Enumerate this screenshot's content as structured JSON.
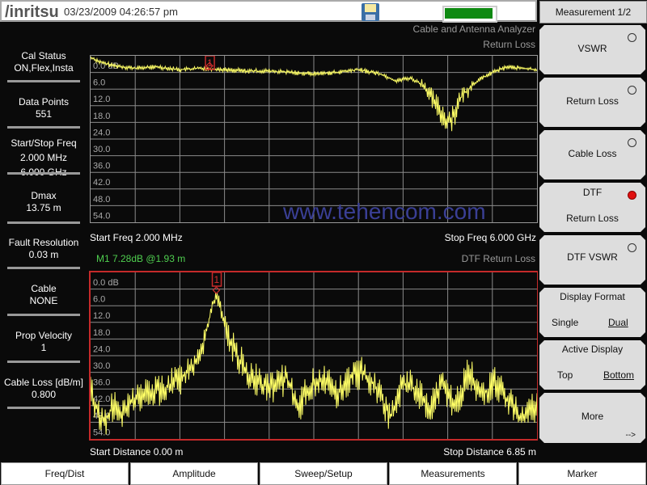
{
  "header": {
    "logo": "/inritsu",
    "datetime": "03/23/2009 04:26:57 pm",
    "icons": [
      "save-disk-icon",
      "battery-icon"
    ],
    "battery_level_percent": 95
  },
  "titles": {
    "instrument": "Cable and Antenna Analyzer",
    "top_measurement": "Return Loss",
    "bottom_measurement": "DTF Return Loss"
  },
  "left_panel": [
    {
      "label": "Cal Status",
      "value": "ON,Flex,Insta"
    },
    {
      "label": "Data Points",
      "value": "551"
    },
    {
      "label": "Start/Stop Freq",
      "value": "2.000 MHz",
      "value2": "6.000 GHz"
    },
    {
      "label": "Dmax",
      "value": "13.75 m"
    },
    {
      "label": "Fault Resolution",
      "value": "0.03 m"
    },
    {
      "label": "Cable",
      "value": "NONE"
    },
    {
      "label": "Prop Velocity",
      "value": "1"
    },
    {
      "label": "Cable Loss [dB/m]",
      "value": "0.800"
    }
  ],
  "top_plot": {
    "start_label": "Start Freq 2.000 MHz",
    "stop_label": "Stop Freq 6.000 GHz",
    "marker_label": "1"
  },
  "bottom_plot": {
    "marker_readout": "M1 7.28dB @1.93 m",
    "start_label": "Start Distance 0.00 m",
    "stop_label": "Stop Distance 6.85 m",
    "marker_label": "1"
  },
  "watermark": "www.tehencom.com",
  "softkeys": {
    "title": "Measurement 1/2",
    "items": [
      {
        "label": "VSWR",
        "radio": "off"
      },
      {
        "label": "Return Loss",
        "radio": "off"
      },
      {
        "label": "Cable Loss",
        "radio": "off"
      },
      {
        "label": "DTF",
        "label2": "Return Loss",
        "radio": "on"
      },
      {
        "label": "DTF VSWR",
        "radio": "off"
      },
      {
        "label": "Display Format",
        "opt1": "Single",
        "opt2": "Dual",
        "selected": "Dual"
      },
      {
        "label": "Active Display",
        "opt1": "Top",
        "opt2": "Bottom",
        "selected": "Bottom"
      },
      {
        "label": "More",
        "arrow": "-->"
      }
    ]
  },
  "tabs": [
    "Freq/Dist",
    "Amplitude",
    "Sweep/Setup",
    "Measurements",
    "Marker"
  ],
  "chart_data": [
    {
      "type": "line",
      "title": "Return Loss",
      "xlabel": "Frequency",
      "ylabel": "dB",
      "x_range": [
        0.002,
        6.0
      ],
      "x_unit": "GHz",
      "ylim": [
        0,
        60
      ],
      "y_inverted": true,
      "y_ticks": [
        "0.0 dB",
        "6.0",
        "12.0",
        "18.0",
        "24.0",
        "30.0",
        "36.0",
        "42.0",
        "48.0",
        "54.0"
      ],
      "grid": true,
      "trace_color": "#ffff66",
      "series": [
        {
          "name": "Return Loss",
          "x": [
            0.002,
            0.15,
            0.3,
            0.6,
            0.9,
            1.2,
            1.5,
            1.8,
            2.1,
            2.4,
            2.7,
            3.0,
            3.3,
            3.6,
            3.9,
            4.1,
            4.3,
            4.5,
            4.6,
            4.7,
            4.8,
            4.9,
            5.0,
            5.2,
            5.4,
            5.6,
            5.8,
            6.0
          ],
          "values": [
            0.5,
            2.5,
            3.5,
            4.5,
            4.0,
            5.0,
            4.5,
            5.0,
            5.5,
            5.5,
            6.0,
            6.5,
            6.0,
            5.0,
            6.5,
            9.0,
            8.0,
            11.0,
            16.0,
            20.0,
            24.0,
            20.0,
            14.0,
            9.0,
            6.0,
            4.0,
            4.5,
            5.0
          ]
        }
      ],
      "markers": [
        {
          "id": "1",
          "x": 1.6,
          "value": 4.5
        }
      ]
    },
    {
      "type": "line",
      "title": "DTF Return Loss",
      "xlabel": "Distance",
      "ylabel": "dB",
      "x_range": [
        0.0,
        6.85
      ],
      "x_unit": "m",
      "ylim": [
        0,
        60
      ],
      "y_inverted": true,
      "y_ticks": [
        "0.0 dB",
        "6.0",
        "12.0",
        "18.0",
        "24.0",
        "30.0",
        "36.0",
        "42.0",
        "48.0",
        "54.0"
      ],
      "grid": true,
      "trace_color": "#ffff66",
      "series": [
        {
          "name": "DTF Return Loss",
          "x": [
            0.0,
            0.1,
            0.2,
            0.35,
            0.5,
            0.65,
            0.8,
            1.0,
            1.2,
            1.4,
            1.6,
            1.75,
            1.85,
            1.93,
            2.0,
            2.1,
            2.25,
            2.4,
            2.6,
            2.8,
            3.0,
            3.2,
            3.4,
            3.6,
            3.8,
            4.0,
            4.2,
            4.4,
            4.6,
            4.8,
            5.0,
            5.2,
            5.4,
            5.6,
            5.8,
            6.0,
            6.2,
            6.4,
            6.6,
            6.85
          ],
          "values": [
            42.0,
            50.0,
            54.0,
            48.0,
            52.0,
            46.0,
            44.0,
            43.0,
            41.0,
            38.0,
            33.0,
            24.0,
            14.0,
            7.28,
            14.0,
            24.0,
            30.0,
            36.0,
            40.0,
            42.0,
            38.0,
            48.0,
            40.0,
            38.0,
            44.0,
            37.0,
            36.0,
            42.0,
            52.0,
            40.0,
            42.0,
            50.0,
            40.0,
            48.0,
            36.0,
            44.0,
            40.0,
            46.0,
            52.0,
            48.0
          ]
        }
      ],
      "markers": [
        {
          "id": "1",
          "x": 1.93,
          "value": 7.28
        }
      ]
    }
  ]
}
